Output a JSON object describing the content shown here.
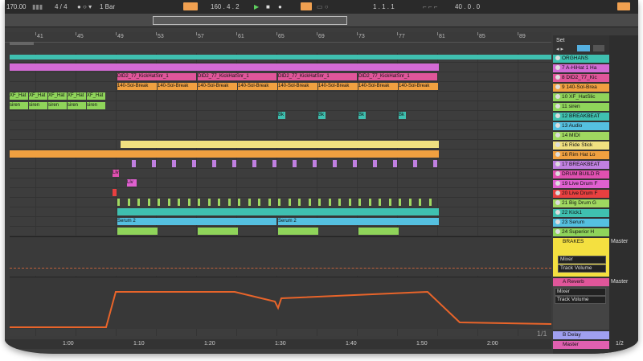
{
  "transport": {
    "tempo": "170.00",
    "signature": "4 / 4",
    "quantize": "1 Bar",
    "position": "160 .  4 .  2",
    "loop_start": "1 .  1 .  1",
    "loop_length": "40 .  0 .  0"
  },
  "ruler": {
    "bars": [
      "41",
      "45",
      "49",
      "53",
      "57",
      "61",
      "65",
      "69",
      "73",
      "77",
      "81",
      "85",
      "89"
    ]
  },
  "timeline": {
    "times": [
      "1:00",
      "1:10",
      "1:20",
      "1:30",
      "1:40",
      "1:50",
      "2:00"
    ]
  },
  "set_label": "Set",
  "tracks": [
    {
      "name": "ORGHANS",
      "color": "#3fc0b0"
    },
    {
      "name": "7 A-HiHat 1 Ha",
      "color": "#d36ad4"
    },
    {
      "name": "8 DID2_77_Kic",
      "color": "#e0569a"
    },
    {
      "name": "9 140-Sol-Brea",
      "color": "#f0a040"
    },
    {
      "name": "10 XF_HatSlic",
      "color": "#8fd45a"
    },
    {
      "name": "11 siren",
      "color": "#8fd45a"
    },
    {
      "name": "12 BREAKBEAT",
      "color": "#3fc0b0"
    },
    {
      "name": "13 Audio",
      "color": "#55c0e0"
    },
    {
      "name": "14 MIDI",
      "color": "#a0d860"
    },
    {
      "name": "16 Ride Stick",
      "color": "#f0e080"
    },
    {
      "name": "16 Rim Hat Lo",
      "color": "#f0a040"
    },
    {
      "name": "17 BREAKBEAT",
      "color": "#c080e0"
    },
    {
      "name": "DRUM BUILD R",
      "color": "#e050b0"
    },
    {
      "name": "19 Live Drum F",
      "color": "#e060d0"
    },
    {
      "name": "20 Live Drum F",
      "color": "#e84040"
    },
    {
      "name": "21 Big Drum G",
      "color": "#a0d860"
    },
    {
      "name": "22 Kick1",
      "color": "#3fc0b0"
    },
    {
      "name": "23 Serum",
      "color": "#55c0e0"
    },
    {
      "name": "24 Superior H",
      "color": "#8fd45a"
    }
  ],
  "brakes": {
    "name": "BRAKES",
    "color": "#f4e040",
    "mixer": "Mixer",
    "volume": "Track Volume",
    "master": "Master"
  },
  "reverb": {
    "name": "A Reverb",
    "color": "#e0569a",
    "mixer": "Mixer",
    "volume": "Track Volume",
    "master": "Master"
  },
  "delay": {
    "name": "B Delay",
    "color": "#a0a0f0"
  },
  "master": {
    "name": "Master",
    "color": "#e060b0"
  },
  "page_counter": "1/1",
  "page_counter_right": "1/2",
  "clip_labels": {
    "kick": "DID2_77_KickHatSnr_1",
    "break": "140-Sol-Break",
    "xf": "XF_Hat",
    "siren": "siren",
    "serum": "Serum 2",
    "bk": "Bk",
    "live": "Liv",
    "ride": "R",
    "rim": "Ri"
  },
  "colors": {
    "automation": "#e8642a"
  }
}
